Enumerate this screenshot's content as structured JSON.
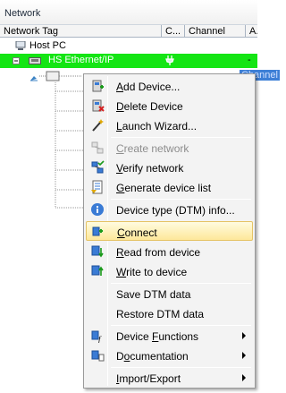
{
  "pane": {
    "title": "Network"
  },
  "columns": [
    "Network Tag",
    "C...",
    "Channel",
    "A..."
  ],
  "tree": {
    "host": "Host PC",
    "ethernet": "HS Ethernet/IP",
    "ethernet_status": "-",
    "child_channel_partial": "Channel"
  },
  "menu": {
    "items": [
      {
        "pre": "",
        "acc": "A",
        "post": "dd Device...",
        "icon": "add-device-icon",
        "disabled": false
      },
      {
        "pre": "",
        "acc": "D",
        "post": "elete Device",
        "icon": "delete-device-icon",
        "disabled": false
      },
      {
        "pre": "",
        "acc": "L",
        "post": "aunch Wizard...",
        "icon": "wizard-wand-icon",
        "disabled": false
      },
      {
        "pre": "",
        "acc": "C",
        "post": "reate network",
        "icon": "create-network-icon",
        "disabled": true
      },
      {
        "pre": "",
        "acc": "V",
        "post": "erify network",
        "icon": "verify-network-icon",
        "disabled": false
      },
      {
        "pre": "",
        "acc": "G",
        "post": "enerate device list",
        "icon": "device-list-icon",
        "disabled": false
      },
      {
        "pre": "Device type (DTM) info...",
        "acc": "",
        "post": "",
        "icon": "info-icon",
        "disabled": false
      },
      {
        "pre": "",
        "acc": "C",
        "post": "onnect",
        "icon": "connect-icon",
        "disabled": false
      },
      {
        "pre": "",
        "acc": "R",
        "post": "ead from device",
        "icon": "read-device-icon",
        "disabled": false
      },
      {
        "pre": "",
        "acc": "W",
        "post": "rite to device",
        "icon": "write-device-icon",
        "disabled": false
      },
      {
        "pre": "Save DTM data",
        "acc": "",
        "post": "",
        "icon": "",
        "disabled": false
      },
      {
        "pre": "Restore DTM data",
        "acc": "",
        "post": "",
        "icon": "",
        "disabled": false
      },
      {
        "pre": "Device ",
        "acc": "F",
        "post": "unctions",
        "icon": "device-functions-icon",
        "disabled": false
      },
      {
        "pre": "D",
        "acc": "o",
        "post": "cumentation",
        "icon": "documentation-icon",
        "disabled": false
      },
      {
        "pre": "",
        "acc": "I",
        "post": "mport/Export",
        "icon": "",
        "disabled": false
      }
    ]
  },
  "colors": {
    "selection": "#14e514",
    "menu_highlight": "#fde89a"
  }
}
